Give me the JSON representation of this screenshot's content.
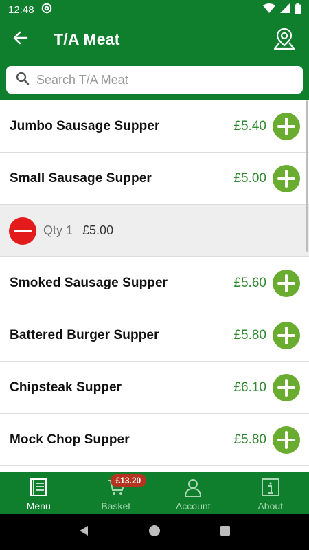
{
  "status_bar": {
    "time": "12:48",
    "icons": [
      "at-sign-icon",
      "wifi-icon",
      "signal-icon",
      "battery-icon"
    ]
  },
  "app_bar": {
    "title": "T/A Meat",
    "back_icon": "arrow-left-icon",
    "map_icon": "map-pin-icon"
  },
  "search": {
    "placeholder": "Search T/A Meat",
    "value": ""
  },
  "menu_items": [
    {
      "name": "Jumbo Sausage Supper",
      "price": "£5.40"
    },
    {
      "name": "Small Sausage Supper",
      "price": "£5.00"
    },
    {
      "name": "Smoked Sausage Supper",
      "price": "£5.60"
    },
    {
      "name": "Battered Burger Supper",
      "price": "£5.80"
    },
    {
      "name": "Chipsteak Supper",
      "price": "£6.10"
    },
    {
      "name": "Mock Chop Supper",
      "price": "£5.80"
    }
  ],
  "selected_item": {
    "qty_label": "Qty",
    "qty": "1",
    "price": "£5.00"
  },
  "bottom_nav": {
    "menu": "Menu",
    "basket": "Basket",
    "basket_total": "£13.20",
    "account": "Account",
    "about": "About"
  },
  "colors": {
    "brand_green": "#0f7f2e",
    "add_green": "#6aac2f",
    "remove_red": "#e31b1b",
    "price_green": "#2f8a2f",
    "badge_red": "#b5331f"
  }
}
